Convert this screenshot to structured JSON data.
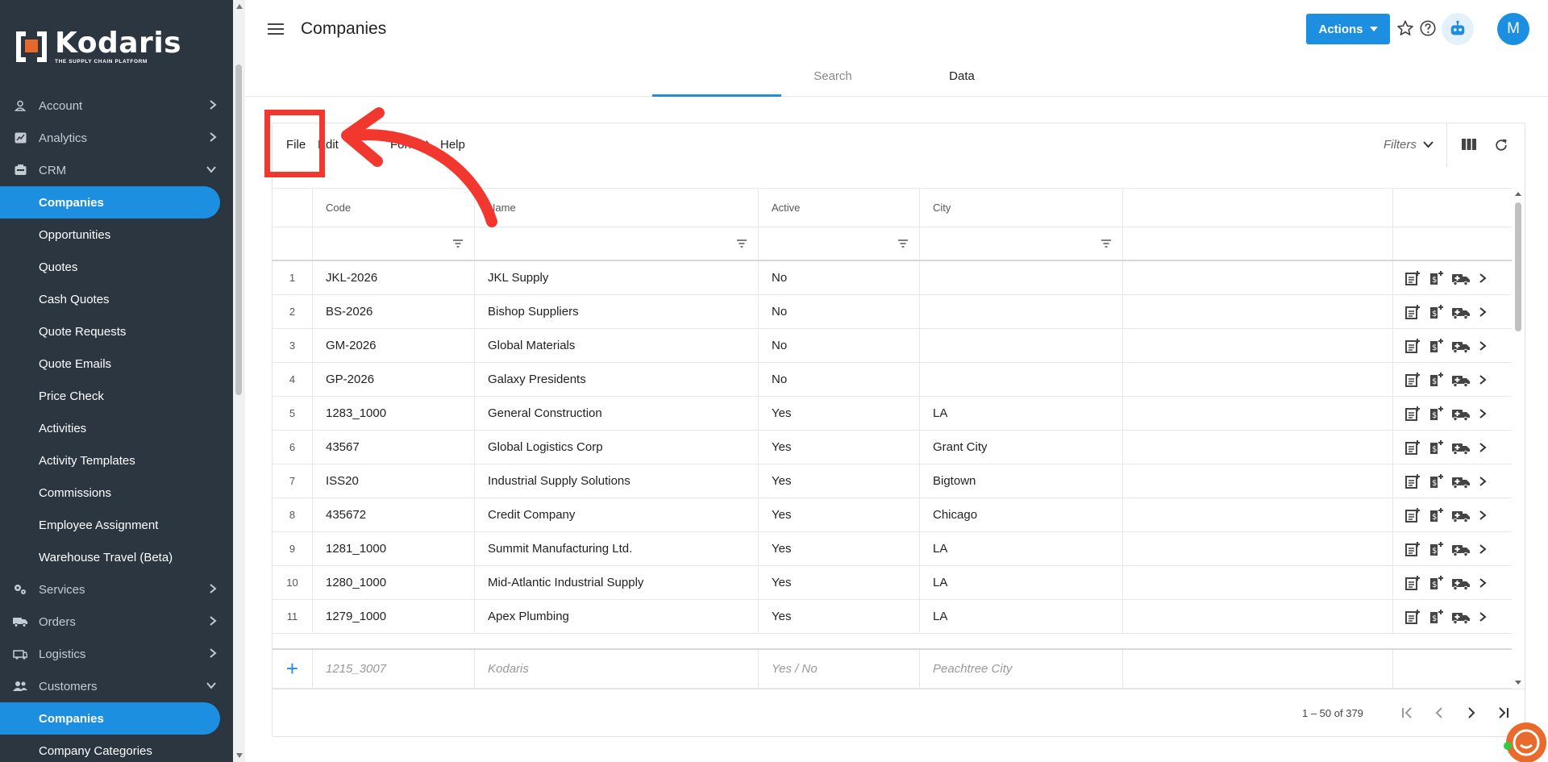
{
  "app": {
    "logo_text": "Kodaris",
    "logo_tagline": "THE SUPPLY CHAIN PLATFORM"
  },
  "sidebar": {
    "top_items": [
      {
        "label": "Account",
        "icon": "user-icon",
        "chevron": "right"
      },
      {
        "label": "Analytics",
        "icon": "analytics-icon",
        "chevron": "right"
      },
      {
        "label": "CRM",
        "icon": "crm-icon",
        "chevron": "down"
      }
    ],
    "crm_children": [
      {
        "label": "Companies",
        "active": true
      },
      {
        "label": "Opportunities"
      },
      {
        "label": "Quotes"
      },
      {
        "label": "Cash Quotes"
      },
      {
        "label": "Quote Requests"
      },
      {
        "label": "Quote Emails"
      },
      {
        "label": "Price Check"
      },
      {
        "label": "Activities"
      },
      {
        "label": "Activity Templates"
      },
      {
        "label": "Commissions"
      },
      {
        "label": "Employee Assignment"
      },
      {
        "label": "Warehouse Travel (Beta)"
      }
    ],
    "bottom_items": [
      {
        "label": "Services",
        "icon": "gears-icon",
        "chevron": "right"
      },
      {
        "label": "Orders",
        "icon": "truck-icon",
        "chevron": "right"
      },
      {
        "label": "Logistics",
        "icon": "logistics-icon",
        "chevron": "right"
      },
      {
        "label": "Customers",
        "icon": "people-icon",
        "chevron": "down"
      }
    ],
    "customers_children": [
      {
        "label": "Companies",
        "active": true
      },
      {
        "label": "Company Categories"
      }
    ]
  },
  "header": {
    "title": "Companies",
    "actions_label": "Actions",
    "avatar_initial": "M",
    "tabs": [
      {
        "label": "Search",
        "active": false
      },
      {
        "label": "Data",
        "active": true
      }
    ]
  },
  "grid": {
    "menu": [
      "File",
      "Edit",
      "Format",
      "Help"
    ],
    "filters_label": "Filters",
    "columns": [
      "Code",
      "Name",
      "Active",
      "City"
    ],
    "rows": [
      {
        "num": "1",
        "code": "JKL-2026",
        "name": "JKL Supply",
        "active": "No",
        "city": ""
      },
      {
        "num": "2",
        "code": "BS-2026",
        "name": "Bishop Suppliers",
        "active": "No",
        "city": ""
      },
      {
        "num": "3",
        "code": "GM-2026",
        "name": "Global Materials",
        "active": "No",
        "city": ""
      },
      {
        "num": "4",
        "code": "GP-2026",
        "name": "Galaxy Presidents",
        "active": "No",
        "city": ""
      },
      {
        "num": "5",
        "code": "1283_1000",
        "name": "General Construction",
        "active": "Yes",
        "city": "LA"
      },
      {
        "num": "6",
        "code": "43567",
        "name": "Global Logistics Corp",
        "active": "Yes",
        "city": "Grant City"
      },
      {
        "num": "7",
        "code": "ISS20",
        "name": "Industrial Supply Solutions",
        "active": "Yes",
        "city": "Bigtown"
      },
      {
        "num": "8",
        "code": "435672",
        "name": "Credit Company",
        "active": "Yes",
        "city": "Chicago"
      },
      {
        "num": "9",
        "code": "1281_1000",
        "name": "Summit Manufacturing Ltd.",
        "active": "Yes",
        "city": "LA"
      },
      {
        "num": "10",
        "code": "1280_1000",
        "name": "Mid-Atlantic Industrial Supply",
        "active": "Yes",
        "city": "LA"
      },
      {
        "num": "11",
        "code": "1279_1000",
        "name": "Apex Plumbing",
        "active": "Yes",
        "city": "LA"
      }
    ],
    "new_row": {
      "code": "1215_3007",
      "name": "Kodaris",
      "active": "Yes / No",
      "city": "Peachtree City"
    },
    "paging": "1 – 50 of 379"
  },
  "colors": {
    "accent": "#1d8fe1",
    "sidebar_bg": "#2b3640",
    "annotation_red": "#f2382e"
  }
}
